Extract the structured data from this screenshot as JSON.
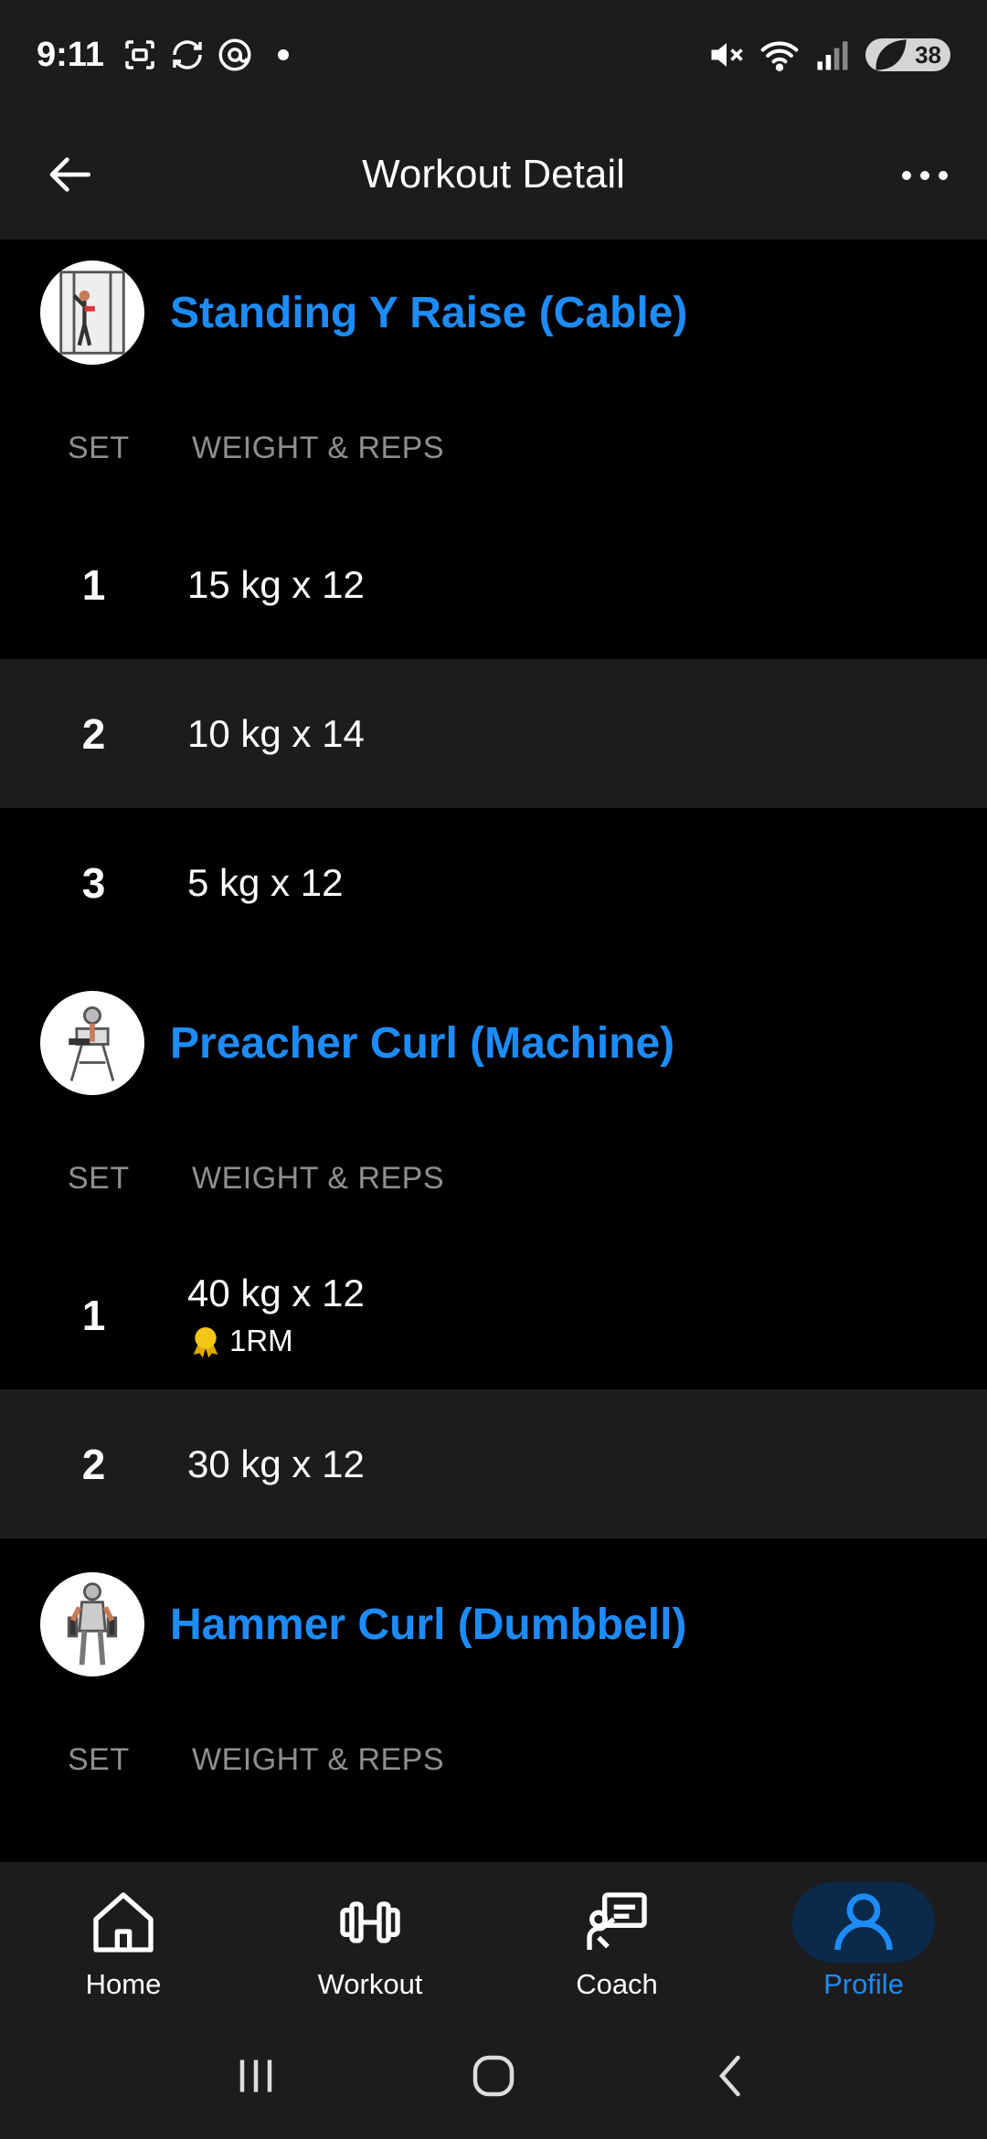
{
  "status": {
    "time": "9:11",
    "battery": "38",
    "icons_left": [
      "screenshot-icon",
      "sync-icon",
      "threads-icon"
    ],
    "icons_right": [
      "mute-icon",
      "wifi-icon",
      "signal-icon",
      "battery-icon"
    ]
  },
  "header": {
    "title": "Workout Detail",
    "back_icon": "arrow-left-icon",
    "more_icon": "more-horizontal-icon"
  },
  "columns": {
    "set": "SET",
    "weight_reps": "WEIGHT & REPS"
  },
  "exercises": [
    {
      "name": "Standing Y Raise (Cable)",
      "sets": [
        {
          "num": "1",
          "value": "15 kg x 12"
        },
        {
          "num": "2",
          "value": "10 kg x 14"
        },
        {
          "num": "3",
          "value": "5 kg x 12"
        }
      ]
    },
    {
      "name": "Preacher Curl (Machine)",
      "sets": [
        {
          "num": "1",
          "value": "40 kg x 12",
          "badge": "1RM"
        },
        {
          "num": "2",
          "value": "30 kg x 12"
        }
      ]
    },
    {
      "name": "Hammer Curl (Dumbbell)",
      "sets": []
    }
  ],
  "nav": {
    "items": [
      {
        "label": "Home",
        "icon": "home-icon"
      },
      {
        "label": "Workout",
        "icon": "dumbbell-icon"
      },
      {
        "label": "Coach",
        "icon": "coach-icon"
      },
      {
        "label": "Profile",
        "icon": "profile-icon",
        "active": true
      }
    ]
  },
  "colors": {
    "accent": "#1d8cf8",
    "surface": "#1c1c1e",
    "background": "#000000",
    "muted_text": "#8e8e93",
    "medal": "#f5c518"
  }
}
